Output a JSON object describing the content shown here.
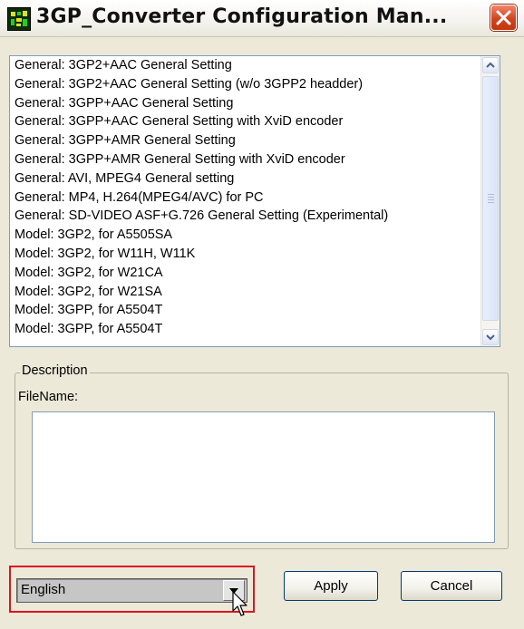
{
  "window": {
    "title": "3GP_Converter Configuration Man..."
  },
  "config_list": {
    "items": [
      "General: 3GP2+AAC General Setting",
      "General: 3GP2+AAC General Setting (w/o 3GPP2 headder)",
      "General: 3GPP+AAC General Setting",
      "General: 3GPP+AAC General Setting with XviD encoder",
      "General: 3GPP+AMR General Setting",
      "General: 3GPP+AMR General Setting with XviD encoder",
      "General: AVI, MPEG4 General setting",
      "General: MP4, H.264(MPEG4/AVC) for PC",
      "General: SD-VIDEO ASF+G.726 General Setting (Experimental)",
      "Model: 3GP2, for A5505SA",
      "Model: 3GP2, for W11H, W11K",
      "Model: 3GP2, for W21CA",
      "Model: 3GP2, for W21SA",
      "Model: 3GPP, for A5504T",
      "Model: 3GPP, for A5504T"
    ]
  },
  "description": {
    "group_label": "Description",
    "filename_label": "FileName:",
    "text": ""
  },
  "language": {
    "selected": "English"
  },
  "buttons": {
    "apply": "Apply",
    "cancel": "Cancel"
  },
  "colors": {
    "highlight_border": "#e0141f",
    "close_button": "#d2431e"
  },
  "icons": {
    "app": "3gp-converter-icon",
    "close": "close-icon",
    "scroll_up": "chevron-up-icon",
    "scroll_down": "chevron-down-icon",
    "dropdown": "dropdown-arrow-icon",
    "cursor": "mouse-pointer-icon"
  }
}
